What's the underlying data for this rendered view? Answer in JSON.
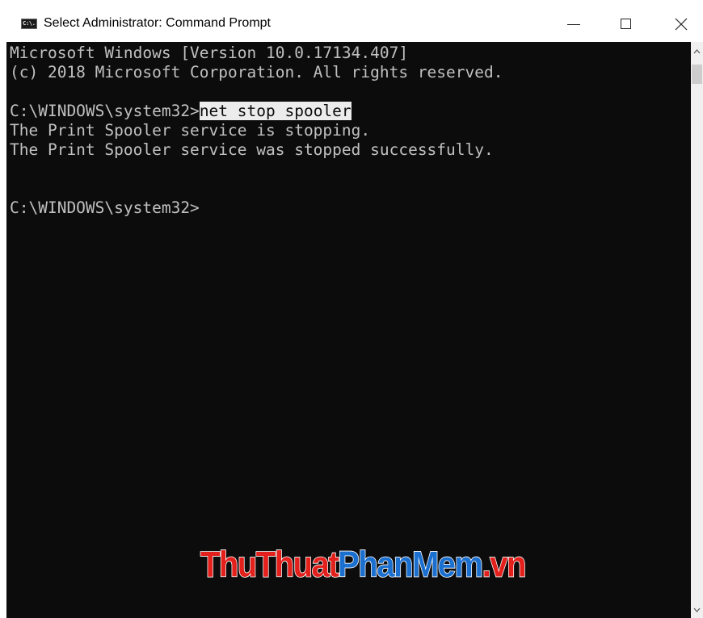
{
  "window": {
    "title": "Select Administrator: Command Prompt",
    "icon": "cmd-icon",
    "icon_text": "C:\\."
  },
  "controls": {
    "minimize_icon": "minimize-icon",
    "maximize_icon": "maximize-icon",
    "close_icon": "close-icon"
  },
  "console": {
    "background": "#0c0c0c",
    "foreground": "#c0c0c0",
    "line1": "Microsoft Windows [Version 10.0.17134.407]",
    "line2": "(c) 2018 Microsoft Corporation. All rights reserved.",
    "prompt1": "C:\\WINDOWS\\system32>",
    "command1": "net stop spooler",
    "output1": "The Print Spooler service is stopping.",
    "output2": "The Print Spooler service was stopped successfully.",
    "prompt2": "C:\\WINDOWS\\system32>"
  },
  "scrollbar": {
    "up_icon": "scroll-up-arrow-icon",
    "down_icon": "scroll-down-arrow-icon"
  },
  "watermark": {
    "part1": "ThuThuat",
    "part2": "PhanMem",
    "part3": ".vn",
    "color_red": "#e3201b",
    "color_blue": "#1b6fcf"
  }
}
